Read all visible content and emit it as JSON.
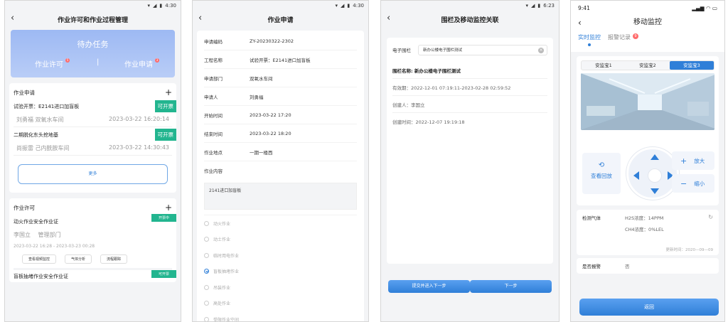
{
  "statusbar": {
    "time_a": "4:30",
    "time_b": "6:23"
  },
  "screen1": {
    "title": "作业许可和作业过程管理",
    "todo": {
      "title": "待办任务",
      "left": "作业许可",
      "left_badge": "5",
      "sep": "|",
      "right": "作业申请",
      "right_badge": "3"
    },
    "apply_section": {
      "title": "作业申请",
      "items": [
        {
          "name": "试验开票：E2141进口加盲板",
          "person": "刘勇福 双氧水车间",
          "time": "2023-03-22 16:20:14",
          "tag": "可开票"
        },
        {
          "name": "二期脱化东头挖地基",
          "person": "尚振雷 己内酰胺车间",
          "time": "2023-03-22 14:30:43",
          "tag": "可开票"
        }
      ],
      "more": "更多"
    },
    "permit_section": {
      "title": "作业许可",
      "items": [
        {
          "name": "动火作业安全作业证",
          "person": "李国立",
          "dept": "管理部门",
          "period": "2023-03-22 16:28 - 2023-03-23 00:28",
          "tag": "开票中",
          "ops": [
            "查看视频监控",
            "气体分析",
            "流程跟踪"
          ]
        },
        {
          "name": "盲板抽堵作业安全作业证",
          "tag": "可开票"
        }
      ]
    }
  },
  "screen2": {
    "title": "作业申请",
    "fields": [
      {
        "k": "申请编码",
        "v": "ZY-20230322-2302"
      },
      {
        "k": "工程名称",
        "v": "试验开票：E2141进口加盲板"
      },
      {
        "k": "申请部门",
        "v": "双氧水车间"
      },
      {
        "k": "申请人",
        "v": "刘勇福"
      },
      {
        "k": "开始时间",
        "v": "2023-03-22 17:20"
      },
      {
        "k": "结束时间",
        "v": "2023-03-22 18:20"
      },
      {
        "k": "作业地点",
        "v": "一期一楼西"
      },
      {
        "k": "作业内容",
        "v": ""
      }
    ],
    "content": "2141进口加盲板",
    "options": [
      "动火作业",
      "临时用电作业",
      "盲板抽堵作业",
      "吊装作业",
      "高处作业",
      "受限作业空间"
    ]
  },
  "screen3": {
    "title": "围栏及移动监控关联",
    "fence_label": "电子围栏",
    "fence_value": "新办公楼电子围栏测试",
    "lines": [
      "围栏名称: 新办公楼电子围栏测试",
      "有效期：2022-12-01 07:19:11-2023-02-28 02:59:52",
      "创建人：李国立",
      "创建时间：2022-12-07 19:19:18"
    ],
    "btn_submit": "提交并进入下一步",
    "btn_next": "下一步"
  },
  "screen4": {
    "time": "9:41",
    "title": "移动监控",
    "tab_live": "实时监控",
    "tab_alarm": "报警记录",
    "tab_alarm_badge": "9",
    "cams": [
      "安监宝1",
      "安监宝2",
      "安监宝3"
    ],
    "playback": "查看回放",
    "zoom_in": "放大",
    "zoom_out": "缩小",
    "gas_label": "检测气体",
    "h2s": "H2S浓度：14PPM",
    "ch4": "CH4浓度：0%LEL",
    "updated": "更新时间：2020—09—09",
    "alarm_label": "是否报警",
    "alarm_value": "否",
    "return": "返回"
  },
  "colors": {
    "accent": "#2f7fd8",
    "tag_green": "#22b58f",
    "badge_red": "#ff6b6b"
  }
}
